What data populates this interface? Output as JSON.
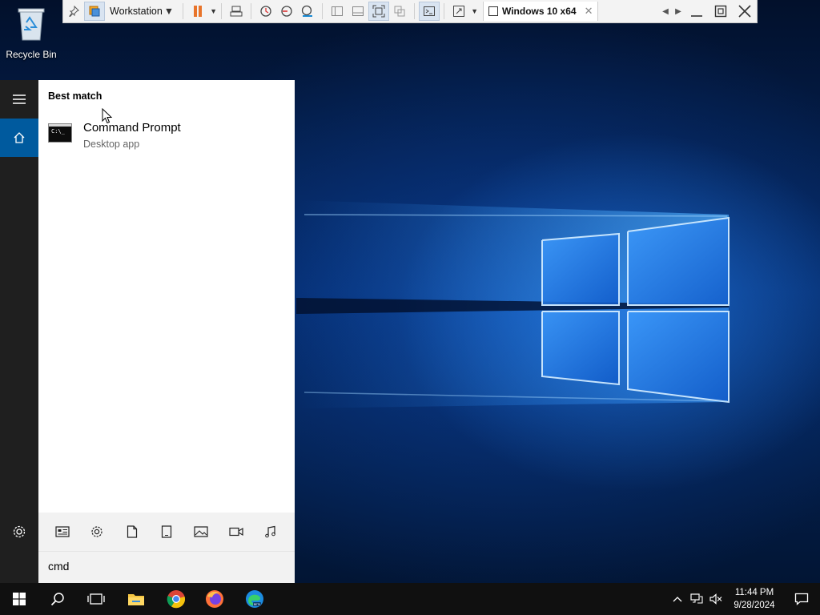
{
  "desktop": {
    "recycle_bin_label": "Recycle Bin"
  },
  "vm_toolbar": {
    "library_label": "Workstation",
    "tab_label": "Windows 10 x64",
    "icons": [
      "pin-icon",
      "library-icon",
      "pause-icon",
      "send-ctrl-alt-del-icon",
      "snapshot-icon",
      "revert-snapshot-icon",
      "snapshot-manager-icon",
      "show-library-icon",
      "thumbnail-icon",
      "full-screen-icon",
      "unity-icon",
      "console-icon",
      "stretch-icon",
      "vm-tab-icon",
      "close-tab-icon",
      "scroll-left-icon",
      "scroll-right-icon",
      "minimize-icon",
      "restore-icon",
      "close-icon"
    ]
  },
  "start_menu": {
    "best_match_label": "Best match",
    "result": {
      "title": "Command Prompt",
      "subtitle": "Desktop app",
      "icon_text": "C:\\_"
    },
    "filters": [
      "apps-filter-icon",
      "settings-filter-icon",
      "documents-filter-icon",
      "tablet-filter-icon",
      "photos-filter-icon",
      "videos-filter-icon",
      "music-filter-icon"
    ],
    "search": {
      "value": "cmd"
    }
  },
  "taskbar": {
    "apps": [
      "start-icon",
      "search-icon",
      "task-view-icon",
      "file-explorer-icon",
      "chrome-icon",
      "firefox-icon",
      "edge-beta-icon"
    ],
    "clock": {
      "time": "11:44 PM",
      "date": "9/28/2024"
    }
  },
  "colors": {
    "accent": "#005a9e",
    "taskbar": "#101010",
    "rail": "#1f1f1f",
    "pause": "#e8742a"
  }
}
